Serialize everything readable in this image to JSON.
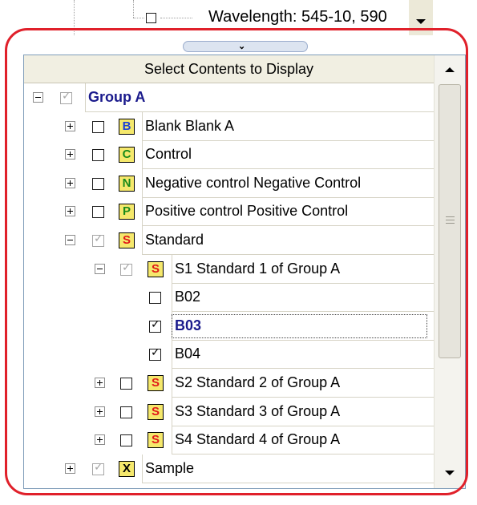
{
  "top": {
    "partial_item": "Wavelength: 545-10, 590"
  },
  "panel": {
    "header": "Select Contents to Display",
    "splitter_icon": "chevron-down-icon"
  },
  "badge_colors": {
    "B": "#1a3fd6",
    "C": "#1a8a1a",
    "N": "#1a8a1a",
    "P": "#1a8a1a",
    "S": "#e01818",
    "X": "#000000"
  },
  "tree": [
    {
      "label": "Group A",
      "level": 0,
      "expander": "minus",
      "checked": true,
      "disabled": true,
      "badge": "",
      "style": "group"
    },
    {
      "label": "Blank Blank A",
      "level": 1,
      "expander": "plus",
      "checked": false,
      "disabled": false,
      "badge": "B"
    },
    {
      "label": "Control",
      "level": 1,
      "expander": "plus",
      "checked": false,
      "disabled": false,
      "badge": "C"
    },
    {
      "label": "Negative control  Negative Control",
      "level": 1,
      "expander": "plus",
      "checked": false,
      "disabled": false,
      "badge": "N"
    },
    {
      "label": "Positive control Positive Control",
      "level": 1,
      "expander": "plus",
      "checked": false,
      "disabled": false,
      "badge": "P"
    },
    {
      "label": "Standard",
      "level": 1,
      "expander": "minus",
      "checked": true,
      "disabled": true,
      "badge": "S"
    },
    {
      "label": "S1 Standard 1 of Group A",
      "level": 2,
      "expander": "minus",
      "checked": true,
      "disabled": true,
      "badge": "S"
    },
    {
      "label": "B02",
      "level": 3,
      "expander": "",
      "checked": false,
      "disabled": false,
      "badge": ""
    },
    {
      "label": "B03",
      "level": 3,
      "expander": "",
      "checked": true,
      "disabled": false,
      "badge": "",
      "style": "selected"
    },
    {
      "label": "B04",
      "level": 3,
      "expander": "",
      "checked": true,
      "disabled": false,
      "badge": ""
    },
    {
      "label": "S2 Standard 2 of Group A",
      "level": 2,
      "expander": "plus",
      "checked": false,
      "disabled": false,
      "badge": "S"
    },
    {
      "label": "S3 Standard 3 of Group A",
      "level": 2,
      "expander": "plus",
      "checked": false,
      "disabled": false,
      "badge": "S"
    },
    {
      "label": "S4 Standard 4 of Group A",
      "level": 2,
      "expander": "plus",
      "checked": false,
      "disabled": false,
      "badge": "S"
    },
    {
      "label": "Sample",
      "level": 1,
      "expander": "plus",
      "checked": true,
      "disabled": true,
      "badge": "X"
    }
  ],
  "highlight_color": "#e0202a"
}
